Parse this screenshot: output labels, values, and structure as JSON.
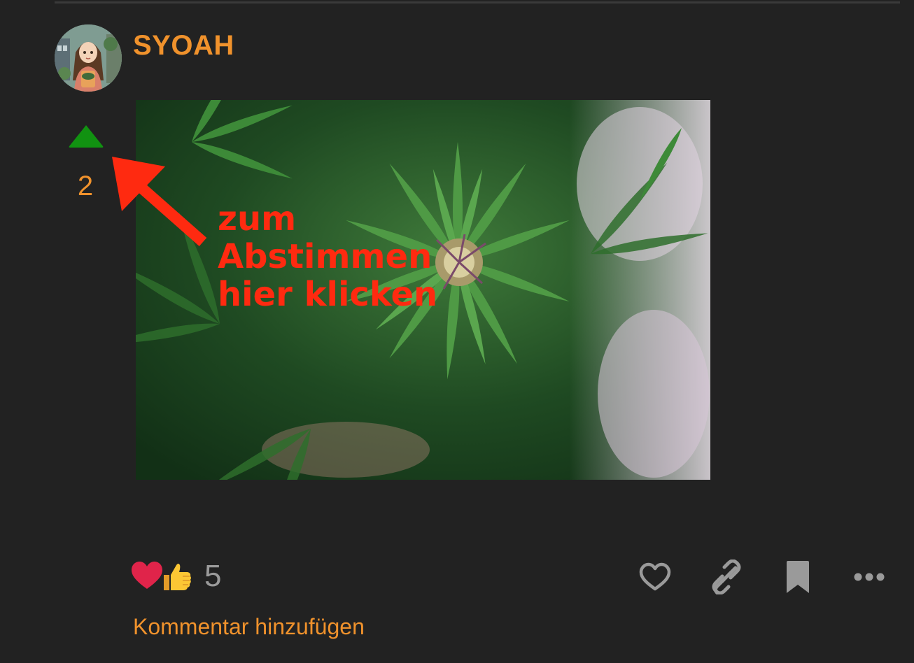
{
  "post": {
    "username": "SYOAH",
    "vote_count": "2",
    "image_annotation": "zum\nAbstimmen\nhier klicken",
    "reaction_count": "5",
    "add_comment_label": "Kommentar hinzufügen"
  },
  "icons": {
    "upvote": "caret-up-icon",
    "like": "heart-outline-icon",
    "copy_link": "link-icon",
    "bookmark": "bookmark-icon",
    "more": "ellipsis-icon",
    "reaction_1": "red-heart-emoji",
    "reaction_2": "thumbs-up-emoji"
  },
  "colors": {
    "background": "#222222",
    "accent": "#f0922c",
    "upvote": "#119211",
    "annotation": "#ff2a10",
    "muted": "#9a9a9a"
  }
}
